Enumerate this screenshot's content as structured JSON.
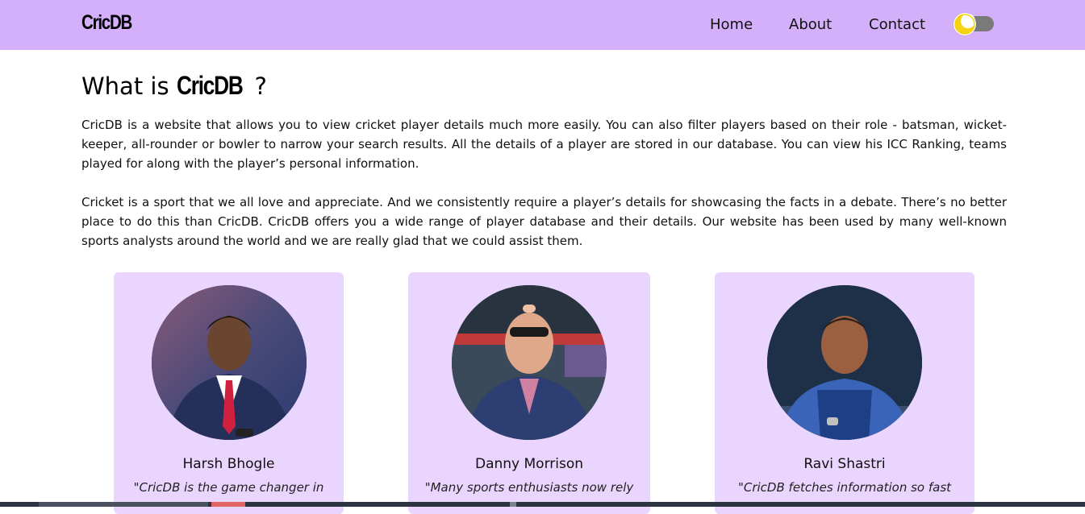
{
  "nav": {
    "brand": "CricDB",
    "links": {
      "home": "Home",
      "about": "About",
      "contact": "Contact"
    },
    "theme_toggle_icon": "moon-icon",
    "colors": {
      "navbar_bg": "#d4b0fb",
      "toggle_track": "#7a7a7a",
      "moon": "#f5d312"
    }
  },
  "about": {
    "title_prefix": "What is",
    "title_brand": "CricDB",
    "title_suffix": "?",
    "paragraph1": "CricDB is a website that allows you to view cricket player details much more easily. You can also filter players based on their role - batsman, wicket-keeper, all-rounder or bowler to narrow your search results. All the details of a player are stored in our database. You can view his ICC Ranking, teams played for along with the player’s personal information.",
    "paragraph2": "Cricket is a sport that we all love and appreciate. And we consistently require a player’s details for showcasing the facts in a debate. There’s no better place to do this than CricDB. CricDB offers you a wide range of player database and their details. Our website has been used by many well-known sports analysts around the world and we are really glad that we could assist them."
  },
  "testimonials": [
    {
      "name": "Harsh Bhogle",
      "quote": "\"CricDB is the game changer in"
    },
    {
      "name": "Danny Morrison",
      "quote": "\"Many sports enthusiasts now rely"
    },
    {
      "name": "Ravi Shastri",
      "quote": "\"CricDB fetches information so fast"
    }
  ],
  "card_color": "#e9d5fd"
}
